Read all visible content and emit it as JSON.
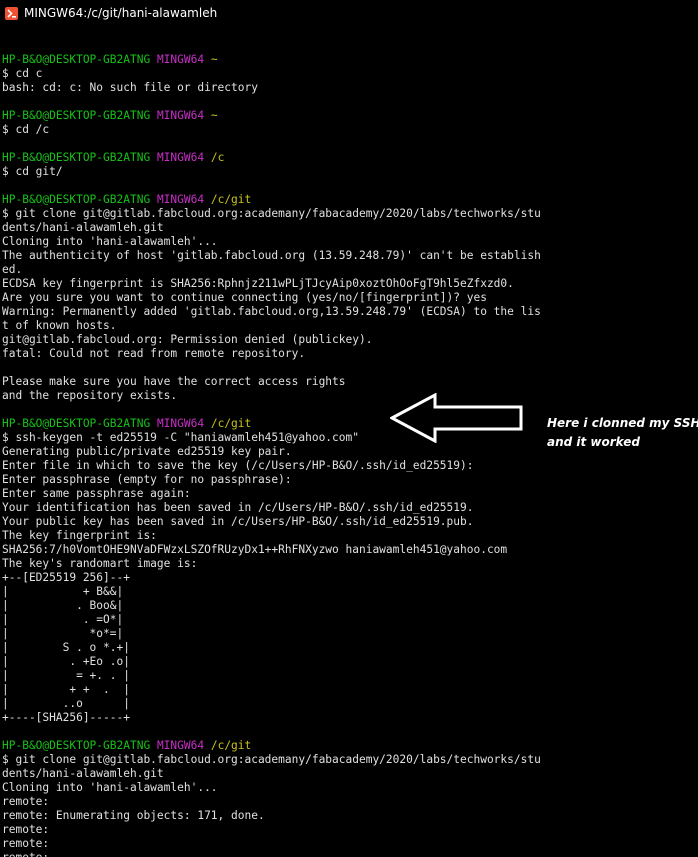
{
  "window": {
    "title": "MINGW64:/c/git/hani-alawamleh",
    "icon": "git-bash-icon"
  },
  "colors": {
    "background": "#000000",
    "text": "#e0e0e0",
    "prompt_user": "#17c217",
    "prompt_shell": "#c72fc7",
    "prompt_path": "#c7c21b",
    "annotation": "#ffffff"
  },
  "terminal": {
    "lines": [
      {
        "type": "blank"
      },
      {
        "type": "prompt",
        "user": "HP-B&O@DESKTOP-GB2ATNG",
        "shell": "MINGW64",
        "path": "~"
      },
      {
        "type": "text",
        "text": "$ cd c"
      },
      {
        "type": "text",
        "text": "bash: cd: c: No such file or directory"
      },
      {
        "type": "blank"
      },
      {
        "type": "prompt",
        "user": "HP-B&O@DESKTOP-GB2ATNG",
        "shell": "MINGW64",
        "path": "~"
      },
      {
        "type": "text",
        "text": "$ cd /c"
      },
      {
        "type": "blank"
      },
      {
        "type": "prompt",
        "user": "HP-B&O@DESKTOP-GB2ATNG",
        "shell": "MINGW64",
        "path": "/c"
      },
      {
        "type": "text",
        "text": "$ cd git/"
      },
      {
        "type": "blank"
      },
      {
        "type": "prompt",
        "user": "HP-B&O@DESKTOP-GB2ATNG",
        "shell": "MINGW64",
        "path": "/c/git"
      },
      {
        "type": "text",
        "text": "$ git clone git@gitlab.fabcloud.org:academany/fabacademy/2020/labs/techworks/stu"
      },
      {
        "type": "text",
        "text": "dents/hani-alawamleh.git"
      },
      {
        "type": "text",
        "text": "Cloning into 'hani-alawamleh'..."
      },
      {
        "type": "text",
        "text": "The authenticity of host 'gitlab.fabcloud.org (13.59.248.79)' can't be establish"
      },
      {
        "type": "text",
        "text": "ed."
      },
      {
        "type": "text",
        "text": "ECDSA key fingerprint is SHA256:Rphnjz211wPLjTJcyAip0xoztOhOoFgT9hl5eZfxzd0."
      },
      {
        "type": "text",
        "text": "Are you sure you want to continue connecting (yes/no/[fingerprint])? yes"
      },
      {
        "type": "text",
        "text": "Warning: Permanently added 'gitlab.fabcloud.org,13.59.248.79' (ECDSA) to the lis"
      },
      {
        "type": "text",
        "text": "t of known hosts."
      },
      {
        "type": "text",
        "text": "git@gitlab.fabcloud.org: Permission denied (publickey)."
      },
      {
        "type": "text",
        "text": "fatal: Could not read from remote repository."
      },
      {
        "type": "blank"
      },
      {
        "type": "text",
        "text": "Please make sure you have the correct access rights"
      },
      {
        "type": "text",
        "text": "and the repository exists."
      },
      {
        "type": "blank"
      },
      {
        "type": "prompt",
        "user": "HP-B&O@DESKTOP-GB2ATNG",
        "shell": "MINGW64",
        "path": "/c/git"
      },
      {
        "type": "text",
        "text": "$ ssh-keygen -t ed25519 -C \"haniawamleh451@yahoo.com\""
      },
      {
        "type": "text",
        "text": "Generating public/private ed25519 key pair."
      },
      {
        "type": "text",
        "text": "Enter file in which to save the key (/c/Users/HP-B&O/.ssh/id_ed25519):"
      },
      {
        "type": "text",
        "text": "Enter passphrase (empty for no passphrase):"
      },
      {
        "type": "text",
        "text": "Enter same passphrase again:"
      },
      {
        "type": "text",
        "text": "Your identification has been saved in /c/Users/HP-B&O/.ssh/id_ed25519."
      },
      {
        "type": "text",
        "text": "Your public key has been saved in /c/Users/HP-B&O/.ssh/id_ed25519.pub."
      },
      {
        "type": "text",
        "text": "The key fingerprint is:"
      },
      {
        "type": "text",
        "text": "SHA256:7/h0VomtOHE9NVaDFWzxLSZOfRUzyDx1++RhFNXyzwo haniawamleh451@yahoo.com"
      },
      {
        "type": "text",
        "text": "The key's randomart image is:"
      },
      {
        "type": "text",
        "text": "+--[ED25519 256]--+"
      },
      {
        "type": "text",
        "text": "|           + B&&|"
      },
      {
        "type": "text",
        "text": "|          . Boo&|"
      },
      {
        "type": "text",
        "text": "|           . =O*|"
      },
      {
        "type": "text",
        "text": "|            *o*=|"
      },
      {
        "type": "text",
        "text": "|        S . o *.+|"
      },
      {
        "type": "text",
        "text": "|         . +Eo .o|"
      },
      {
        "type": "text",
        "text": "|          = +. . |"
      },
      {
        "type": "text",
        "text": "|         + +  .  |"
      },
      {
        "type": "text",
        "text": "|        ..o      |"
      },
      {
        "type": "text",
        "text": "+----[SHA256]-----+"
      },
      {
        "type": "blank"
      },
      {
        "type": "prompt",
        "user": "HP-B&O@DESKTOP-GB2ATNG",
        "shell": "MINGW64",
        "path": "/c/git"
      },
      {
        "type": "text",
        "text": "$ git clone git@gitlab.fabcloud.org:academany/fabacademy/2020/labs/techworks/stu"
      },
      {
        "type": "text",
        "text": "dents/hani-alawamleh.git"
      },
      {
        "type": "text",
        "text": "Cloning into 'hani-alawamleh'..."
      },
      {
        "type": "text",
        "text": "remote:"
      },
      {
        "type": "text",
        "text": "remote: Enumerating objects: 171, done."
      },
      {
        "type": "text",
        "text": "remote:"
      },
      {
        "type": "text",
        "text": "remote:"
      },
      {
        "type": "text",
        "text": "remote:"
      }
    ]
  },
  "annotation": {
    "arrow_icon": "left-arrow-icon",
    "text_line1": "Here i clonned my SSH",
    "text_line2": "and it worked"
  }
}
